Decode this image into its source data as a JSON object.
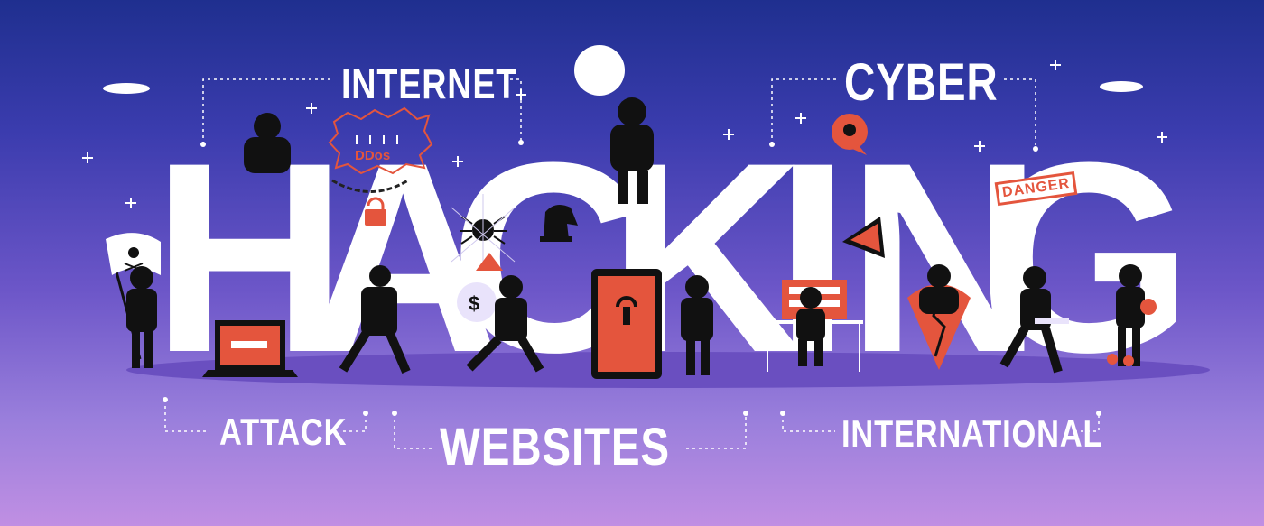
{
  "headline": {
    "letters": [
      "H",
      "A",
      "C",
      "K",
      "I",
      "N",
      "G"
    ]
  },
  "labels": {
    "internet": "INTERNET",
    "cyber": "CYBER",
    "attack": "ATTACK",
    "websites": "WEBSITES",
    "international": "INTERNATIONAL"
  },
  "badges": {
    "ddos": "DDos",
    "danger": "DANGER"
  },
  "colors": {
    "sky_top": "#1f2f8f",
    "sky_bottom": "#c08fe3",
    "text": "#ffffff",
    "accent": "#e4553d",
    "figure": "#111111"
  }
}
